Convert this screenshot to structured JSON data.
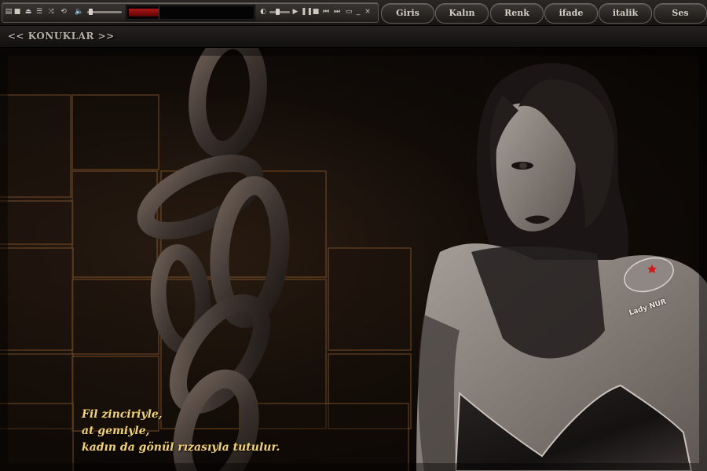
{
  "nav": {
    "buttons": [
      {
        "label": "Giris"
      },
      {
        "label": "Kalın"
      },
      {
        "label": "Renk"
      },
      {
        "label": "ifade"
      },
      {
        "label": "italik"
      },
      {
        "label": "Ses"
      }
    ]
  },
  "section": {
    "title": "<< KONUKLAR >>"
  },
  "poem": {
    "lines": [
      "Fil zinciriyle,",
      "at gemiyle,",
      "kadın da gönül rızasıyla tutulur."
    ]
  },
  "watermark": {
    "text": "Lady NUR"
  },
  "colors": {
    "poem": "#f0d27a",
    "badge_red": "#d01818",
    "background": "#0b0806"
  }
}
